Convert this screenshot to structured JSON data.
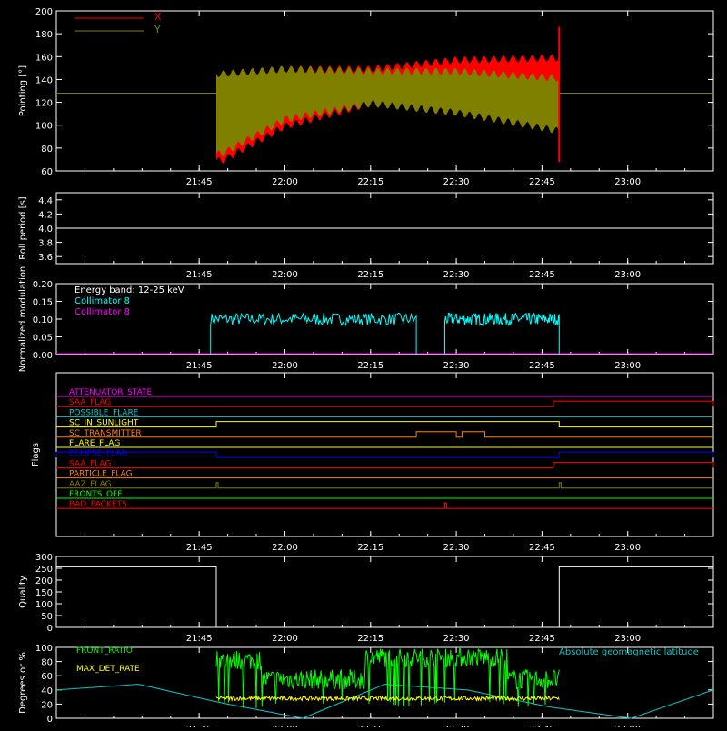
{
  "colors": {
    "background": "#000000",
    "axes": "#ffffff",
    "x_pointing": "#ff0000",
    "y_pointing": "#808000",
    "collimator8": "#00ffff",
    "collimator_magenta": "#ff00ff",
    "front_ratio": "#00ff00",
    "max_det_rate": "#ffff00",
    "geomag": "#00cccc"
  },
  "time_ticks": [
    "21:45",
    "22:00",
    "22:15",
    "22:30",
    "22:45",
    "23:00"
  ],
  "chart_data": [
    {
      "id": "pointing",
      "type": "area",
      "ylabel": "Pointing [°]",
      "ylim": [
        60,
        200
      ],
      "yticks": [
        "200",
        "180",
        "160",
        "140",
        "120",
        "100",
        "80",
        "60"
      ],
      "legend": [
        "X",
        "Y"
      ],
      "legend_placement": "top-left",
      "series": [
        {
          "name": "X",
          "constant_before_after": 128,
          "band_start": "21:48",
          "band_end": "22:48",
          "upper": [
            [
              "21:49",
              148
            ],
            [
              "22:00",
              152
            ],
            [
              "22:15",
              152
            ],
            [
              "22:30",
              160
            ],
            [
              "22:48",
              162
            ]
          ],
          "lower": [
            [
              "21:49",
              66
            ],
            [
              "22:00",
              96
            ],
            [
              "22:15",
              116
            ],
            [
              "22:30",
              112
            ],
            [
              "22:48",
              106
            ]
          ]
        },
        {
          "name": "Y",
          "constant_before_after": 128,
          "band_start": "21:48",
          "band_end": "22:48",
          "upper": [
            [
              "21:49",
              148
            ],
            [
              "22:00",
              152
            ],
            [
              "22:15",
              150
            ],
            [
              "22:30",
              150
            ],
            [
              "22:48",
              144
            ]
          ],
          "lower": [
            [
              "21:49",
              72
            ],
            [
              "22:00",
              102
            ],
            [
              "22:15",
              116
            ],
            [
              "22:30",
              108
            ],
            [
              "22:48",
              92
            ]
          ]
        }
      ]
    },
    {
      "id": "roll",
      "type": "line",
      "ylabel": "Roll period [s]",
      "ylim": [
        3.5,
        4.5
      ],
      "yticks": [
        "4.4",
        "4.2",
        "4.0",
        "3.8",
        "3.6"
      ],
      "series": [
        {
          "values": [
            4.0
          ]
        }
      ]
    },
    {
      "id": "modulation",
      "type": "line",
      "ylabel": "Normalized modulation",
      "ylim": [
        0.0,
        0.2
      ],
      "yticks": [
        "0.20",
        "0.15",
        "0.10",
        "0.05",
        "0.00"
      ],
      "annotations": [
        "Energy band: 12-25 keV",
        "Collimator 8",
        "Collimator 8"
      ],
      "series": [
        {
          "name": "Collimator 8",
          "segments": [
            [
              "21:47",
              "22:23",
              0.1
            ],
            [
              "22:28",
              "22:48",
              0.1
            ]
          ]
        }
      ]
    },
    {
      "id": "flags",
      "type": "line",
      "ylabel": "Flags",
      "flags": [
        {
          "label": "ATTENUATOR_STATE",
          "color": "#ff00ff",
          "high": []
        },
        {
          "label": "SAA_FLAG",
          "color": "#ff0000",
          "high": [
            [
              "22:47",
              "23:15"
            ]
          ]
        },
        {
          "label": "POSSIBLE_FLARE",
          "color": "#00cccc",
          "high": []
        },
        {
          "label": "SC_IN_SUNLIGHT",
          "color": "#ffff00",
          "high": [
            [
              "21:48",
              "22:48"
            ]
          ]
        },
        {
          "label": "SC_TRANSMITTER",
          "color": "#ff8000",
          "high": [
            [
              "22:23",
              "22:30"
            ],
            [
              "22:31",
              "22:35"
            ]
          ]
        },
        {
          "label": "FLARE_FLAG",
          "color": "#ffff00",
          "high": []
        },
        {
          "label": "ECLIPSE_FLAG",
          "color": "#0000ff",
          "high": [
            [
              "21:20",
              "21:48"
            ],
            [
              "22:48",
              "23:15"
            ]
          ]
        },
        {
          "label": "SAA_FLAG",
          "color": "#ff0000",
          "high": [
            [
              "22:47",
              "23:15"
            ]
          ]
        },
        {
          "label": "PARTICLE_FLAG",
          "color": "#ff8000",
          "high": []
        },
        {
          "label": "AAZ_FLAG",
          "color": "#808000",
          "high": [
            [
              "21:48",
              "21:48"
            ],
            [
              "22:48",
              "22:48"
            ]
          ]
        },
        {
          "label": "FRONTS_OFF",
          "color": "#00ff00",
          "high": []
        },
        {
          "label": "BAD_PACKETS",
          "color": "#ff0000",
          "high": [
            [
              "22:28",
              "22:28"
            ]
          ]
        }
      ]
    },
    {
      "id": "quality",
      "type": "line",
      "ylabel": "Quality",
      "ylim": [
        0,
        300
      ],
      "yticks": [
        "300",
        "250",
        "200",
        "150",
        "100",
        "50",
        "0"
      ],
      "series": [
        {
          "segments": [
            [
              "21:20",
              "21:48",
              256
            ],
            [
              "21:48",
              "22:48",
              0
            ],
            [
              "22:48",
              "23:15",
              256
            ]
          ]
        }
      ]
    },
    {
      "id": "geo",
      "type": "line",
      "ylabel": "Degrees or %",
      "ylim": [
        0,
        100
      ],
      "yticks": [
        "100",
        "80",
        "60",
        "40",
        "20",
        "0"
      ],
      "legend": [
        "FRONT_RATIO",
        "MAX_DET_RATE",
        "Absolute geomagnetic latitude"
      ],
      "series": [
        {
          "name": "FRONT_RATIO",
          "values": [
            88,
            50,
            90,
            88,
            60,
            90
          ]
        },
        {
          "name": "MAX_DET_RATE",
          "values": [
            28,
            28,
            28,
            30,
            30,
            28
          ]
        },
        {
          "name": "Absolute geomagnetic latitude",
          "values": [
            40,
            48,
            22,
            0,
            48,
            40,
            16,
            0,
            40
          ]
        }
      ]
    }
  ]
}
